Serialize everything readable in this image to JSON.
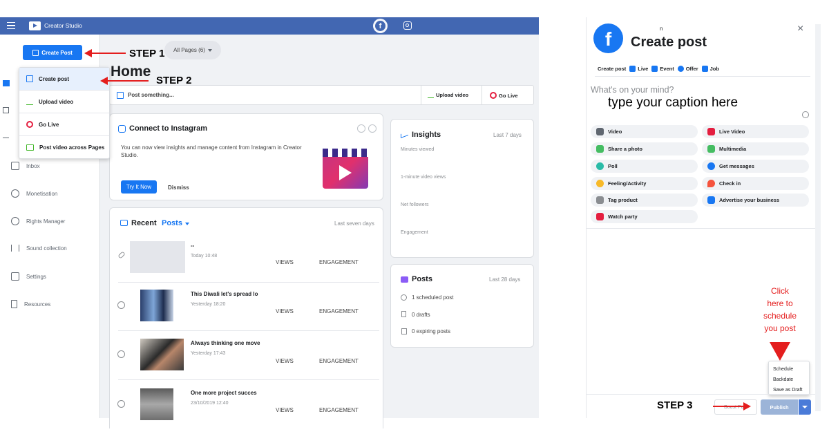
{
  "topbar": {
    "app_name": "Creator Studio"
  },
  "sidebar": {
    "create_post_label": "Create Post",
    "items": [
      {
        "label": "Inbox",
        "icon": "inbox-icon"
      },
      {
        "label": "Monetisation",
        "icon": "dollar-icon"
      },
      {
        "label": "Rights Manager",
        "icon": "copyright-icon"
      },
      {
        "label": "Sound collection",
        "icon": "soundwave-icon"
      },
      {
        "label": "Settings",
        "icon": "settings-icon"
      },
      {
        "label": "Resources",
        "icon": "resources-icon"
      }
    ]
  },
  "dropdown_menu": {
    "items": [
      {
        "label": "Create post",
        "icon": "edit-icon"
      },
      {
        "label": "Upload video",
        "icon": "upload-icon"
      },
      {
        "label": "Go Live",
        "icon": "live-icon"
      },
      {
        "label": "Post video across Pages",
        "icon": "crosspost-icon"
      }
    ]
  },
  "main": {
    "pages_selector": "All Pages (6)",
    "title": "Home",
    "composer": {
      "placeholder": "Post something...",
      "upload_label": "Upload video",
      "golive_label": "Go Live"
    },
    "instagram": {
      "title": "Connect to Instagram",
      "body": "You can now view insights and manage content from Instagram in Creator Studio.",
      "try_label": "Try It Now",
      "dismiss_label": "Dismiss"
    },
    "recent": {
      "title": "Recent",
      "title_accent": "Posts",
      "period": "Last seven days",
      "views_label": "VIEWS",
      "engagement_label": "ENGAGEMENT",
      "posts": [
        {
          "title": "--",
          "time": "Today 10:48"
        },
        {
          "title": "This Diwali let's spread lo",
          "time": "Yesterday 18:20"
        },
        {
          "title": "Always thinking one move",
          "time": "Yesterday 17:43"
        },
        {
          "title": "One more project succes",
          "time": "23/10/2019 12:40"
        }
      ]
    },
    "insights": {
      "title": "Insights",
      "period": "Last 7 days",
      "metrics": [
        "Minutes viewed",
        "1-minute video views",
        "Net followers",
        "Engagement"
      ]
    },
    "posts_card": {
      "title": "Posts",
      "period": "Last 28 days",
      "rows": [
        "1 scheduled post",
        "0 drafts",
        "0 expiring posts"
      ]
    }
  },
  "steps": {
    "step1": "STEP 1",
    "step2": "STEP 2",
    "step3": "STEP 3"
  },
  "modal": {
    "page_initial": "n",
    "title": "Create post",
    "tabs": [
      "Create post",
      "Live",
      "Event",
      "Offer",
      "Job"
    ],
    "placeholder": "What's on your mind?",
    "caption_hint": "type your caption here",
    "options": [
      {
        "label": "Video",
        "icon": "video-icon",
        "color": "#606770"
      },
      {
        "label": "Live Video",
        "icon": "live-badge-icon",
        "color": "#e41e3f"
      },
      {
        "label": "Share a photo",
        "icon": "photo-icon",
        "color": "#45bd62"
      },
      {
        "label": "Multimedia",
        "icon": "multimedia-icon",
        "color": "#45bd62"
      },
      {
        "label": "Poll",
        "icon": "poll-icon",
        "color": "#2abba7"
      },
      {
        "label": "Get messages",
        "icon": "messenger-icon",
        "color": "#1877f2"
      },
      {
        "label": "Feeling/Activity",
        "icon": "smiley-icon",
        "color": "#f7b928"
      },
      {
        "label": "Check in",
        "icon": "location-pin-icon",
        "color": "#f5533d"
      },
      {
        "label": "Tag product",
        "icon": "tag-icon",
        "color": "#8a8d91"
      },
      {
        "label": "Advertise your business",
        "icon": "megaphone-icon",
        "color": "#1877f2"
      },
      {
        "label": "Watch party",
        "icon": "popcorn-icon",
        "color": "#e41e3f"
      }
    ],
    "annotation": [
      "Click",
      "here to",
      "schedule",
      "you post"
    ],
    "publish_menu": [
      "Schedule",
      "Backdate",
      "Save as Draft"
    ],
    "boost_label": "Boost Post",
    "publish_label": "Publish"
  },
  "colors": {
    "brand_blue": "#1877f2",
    "topbar": "#4267b2",
    "annotation_red": "#e41e1e"
  }
}
